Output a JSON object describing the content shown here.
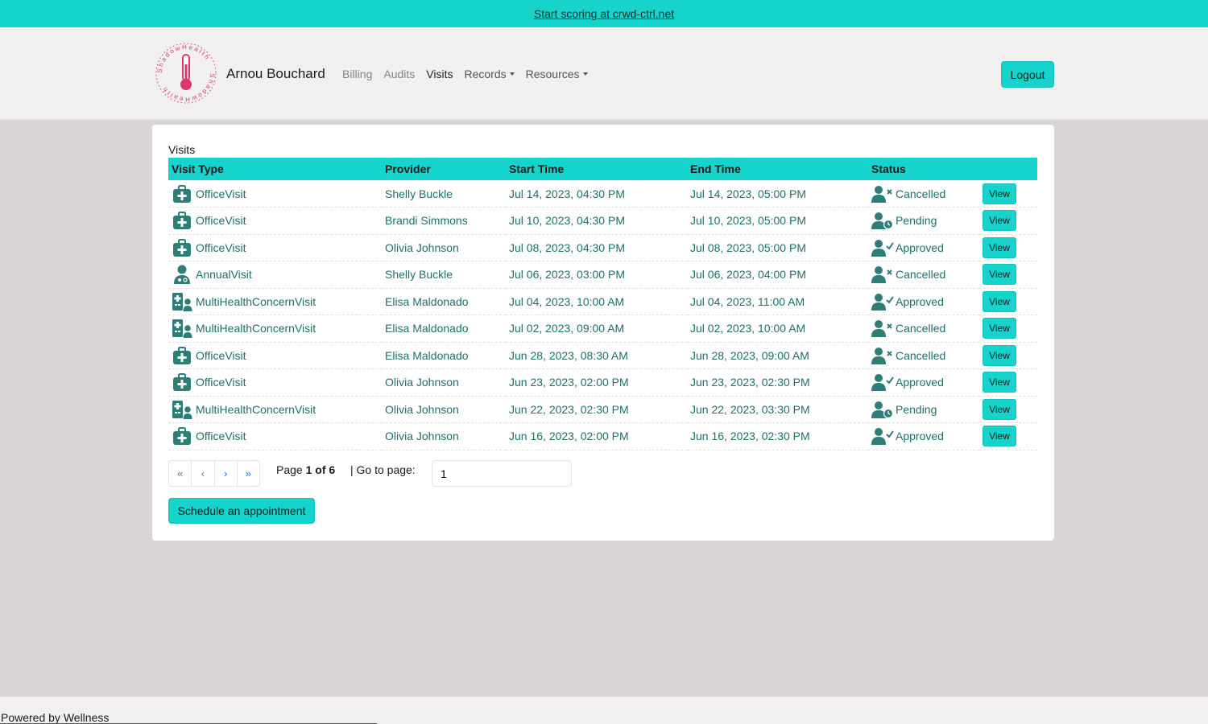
{
  "banner": {
    "text": "Start scoring at crwd-ctrl.net"
  },
  "header": {
    "logo_text": "ShadowHealth",
    "brand": "Arnou Bouchard",
    "nav": [
      {
        "label": "Billing",
        "dropdown": false,
        "active": false
      },
      {
        "label": "Audits",
        "dropdown": false,
        "active": false
      },
      {
        "label": "Visits",
        "dropdown": false,
        "active": true
      },
      {
        "label": "Records",
        "dropdown": true,
        "active": false
      },
      {
        "label": "Resources",
        "dropdown": true,
        "active": false
      }
    ],
    "logout_label": "Logout"
  },
  "visits": {
    "title": "Visits",
    "columns": [
      "Visit Type",
      "Provider",
      "Start Time",
      "End Time",
      "Status"
    ],
    "view_label": "View",
    "rows": [
      {
        "type": "OfficeVisit",
        "icon": "medkit-icon",
        "provider": "Shelly Buckle",
        "start": "Jul 14, 2023, 04:30 PM",
        "end": "Jul 14, 2023, 05:00 PM",
        "status": "Cancelled",
        "status_icon": "user-xmark-icon"
      },
      {
        "type": "OfficeVisit",
        "icon": "medkit-icon",
        "provider": "Brandi Simmons",
        "start": "Jul 10, 2023, 04:30 PM",
        "end": "Jul 10, 2023, 05:00 PM",
        "status": "Pending",
        "status_icon": "user-clock-icon"
      },
      {
        "type": "OfficeVisit",
        "icon": "medkit-icon",
        "provider": "Olivia Johnson",
        "start": "Jul 08, 2023, 04:30 PM",
        "end": "Jul 08, 2023, 05:00 PM",
        "status": "Approved",
        "status_icon": "user-check-icon"
      },
      {
        "type": "AnnualVisit",
        "icon": "user-doctor-icon",
        "provider": "Shelly Buckle",
        "start": "Jul 06, 2023, 03:00 PM",
        "end": "Jul 06, 2023, 04:00 PM",
        "status": "Cancelled",
        "status_icon": "user-xmark-icon"
      },
      {
        "type": "MultiHealthConcernVisit",
        "icon": "hospital-user-icon",
        "provider": "Elisa Maldonado",
        "start": "Jul 04, 2023, 10:00 AM",
        "end": "Jul 04, 2023, 11:00 AM",
        "status": "Approved",
        "status_icon": "user-check-icon"
      },
      {
        "type": "MultiHealthConcernVisit",
        "icon": "hospital-user-icon",
        "provider": "Elisa Maldonado",
        "start": "Jul 02, 2023, 09:00 AM",
        "end": "Jul 02, 2023, 10:00 AM",
        "status": "Cancelled",
        "status_icon": "user-xmark-icon"
      },
      {
        "type": "OfficeVisit",
        "icon": "medkit-icon",
        "provider": "Elisa Maldonado",
        "start": "Jun 28, 2023, 08:30 AM",
        "end": "Jun 28, 2023, 09:00 AM",
        "status": "Cancelled",
        "status_icon": "user-xmark-icon"
      },
      {
        "type": "OfficeVisit",
        "icon": "medkit-icon",
        "provider": "Olivia Johnson",
        "start": "Jun 23, 2023, 02:00 PM",
        "end": "Jun 23, 2023, 02:30 PM",
        "status": "Approved",
        "status_icon": "user-check-icon"
      },
      {
        "type": "MultiHealthConcernVisit",
        "icon": "hospital-user-icon",
        "provider": "Olivia Johnson",
        "start": "Jun 22, 2023, 02:30 PM",
        "end": "Jun 22, 2023, 03:30 PM",
        "status": "Pending",
        "status_icon": "user-clock-icon"
      },
      {
        "type": "OfficeVisit",
        "icon": "medkit-icon",
        "provider": "Olivia Johnson",
        "start": "Jun 16, 2023, 02:00 PM",
        "end": "Jun 16, 2023, 02:30 PM",
        "status": "Approved",
        "status_icon": "user-check-icon"
      }
    ]
  },
  "pagination": {
    "first": "«",
    "prev": "‹",
    "next": "›",
    "last": "»",
    "page_prefix": "Page ",
    "page_current": "1 of 6",
    "goto_label": "| Go to page:",
    "goto_value": "1"
  },
  "schedule_label": "Schedule an appointment",
  "footer": {
    "text": "Powered by Wellness"
  },
  "colors": {
    "accent": "#16d3cc",
    "link": "#1e6f6c",
    "icon": "#2f7d79",
    "logo": "#d9386e"
  }
}
